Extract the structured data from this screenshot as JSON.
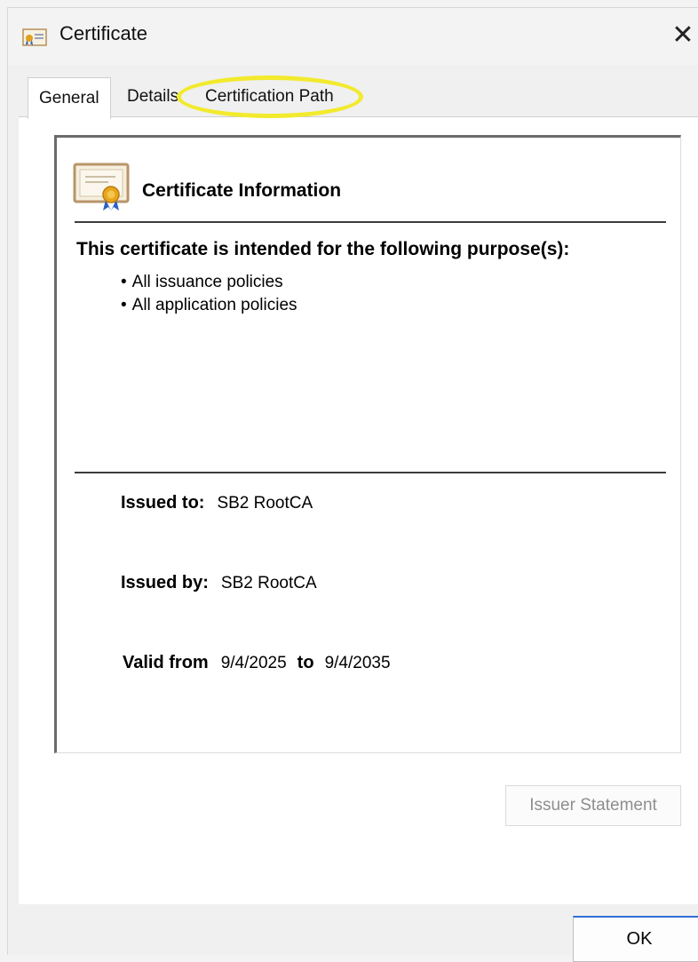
{
  "window": {
    "title": "Certificate",
    "close_glyph": "✕"
  },
  "tabs": [
    {
      "label": "General",
      "active": true
    },
    {
      "label": "Details",
      "active": false
    },
    {
      "label": "Certification Path",
      "active": false,
      "highlighted": true
    }
  ],
  "info": {
    "heading": "Certificate Information",
    "purpose_heading": "This certificate is intended for the following purpose(s):",
    "purposes": [
      "All issuance policies",
      "All application policies"
    ],
    "issued_to_label": "Issued to:",
    "issued_to": "SB2 RootCA",
    "issued_by_label": "Issued by:",
    "issued_by": "SB2 RootCA",
    "valid_from_label": "Valid from",
    "valid_from": "9/4/2025",
    "to_label": "to",
    "valid_to": "9/4/2035"
  },
  "buttons": {
    "issuer_statement": "Issuer Statement",
    "ok": "OK"
  },
  "icons": {
    "title": "certificate-icon",
    "info": "certificate-large-icon",
    "close": "close-icon"
  },
  "colors": {
    "highlight": "#f2ea2c",
    "ok_accent": "#2f6fd6",
    "disabled_text": "#8e8e8e"
  }
}
